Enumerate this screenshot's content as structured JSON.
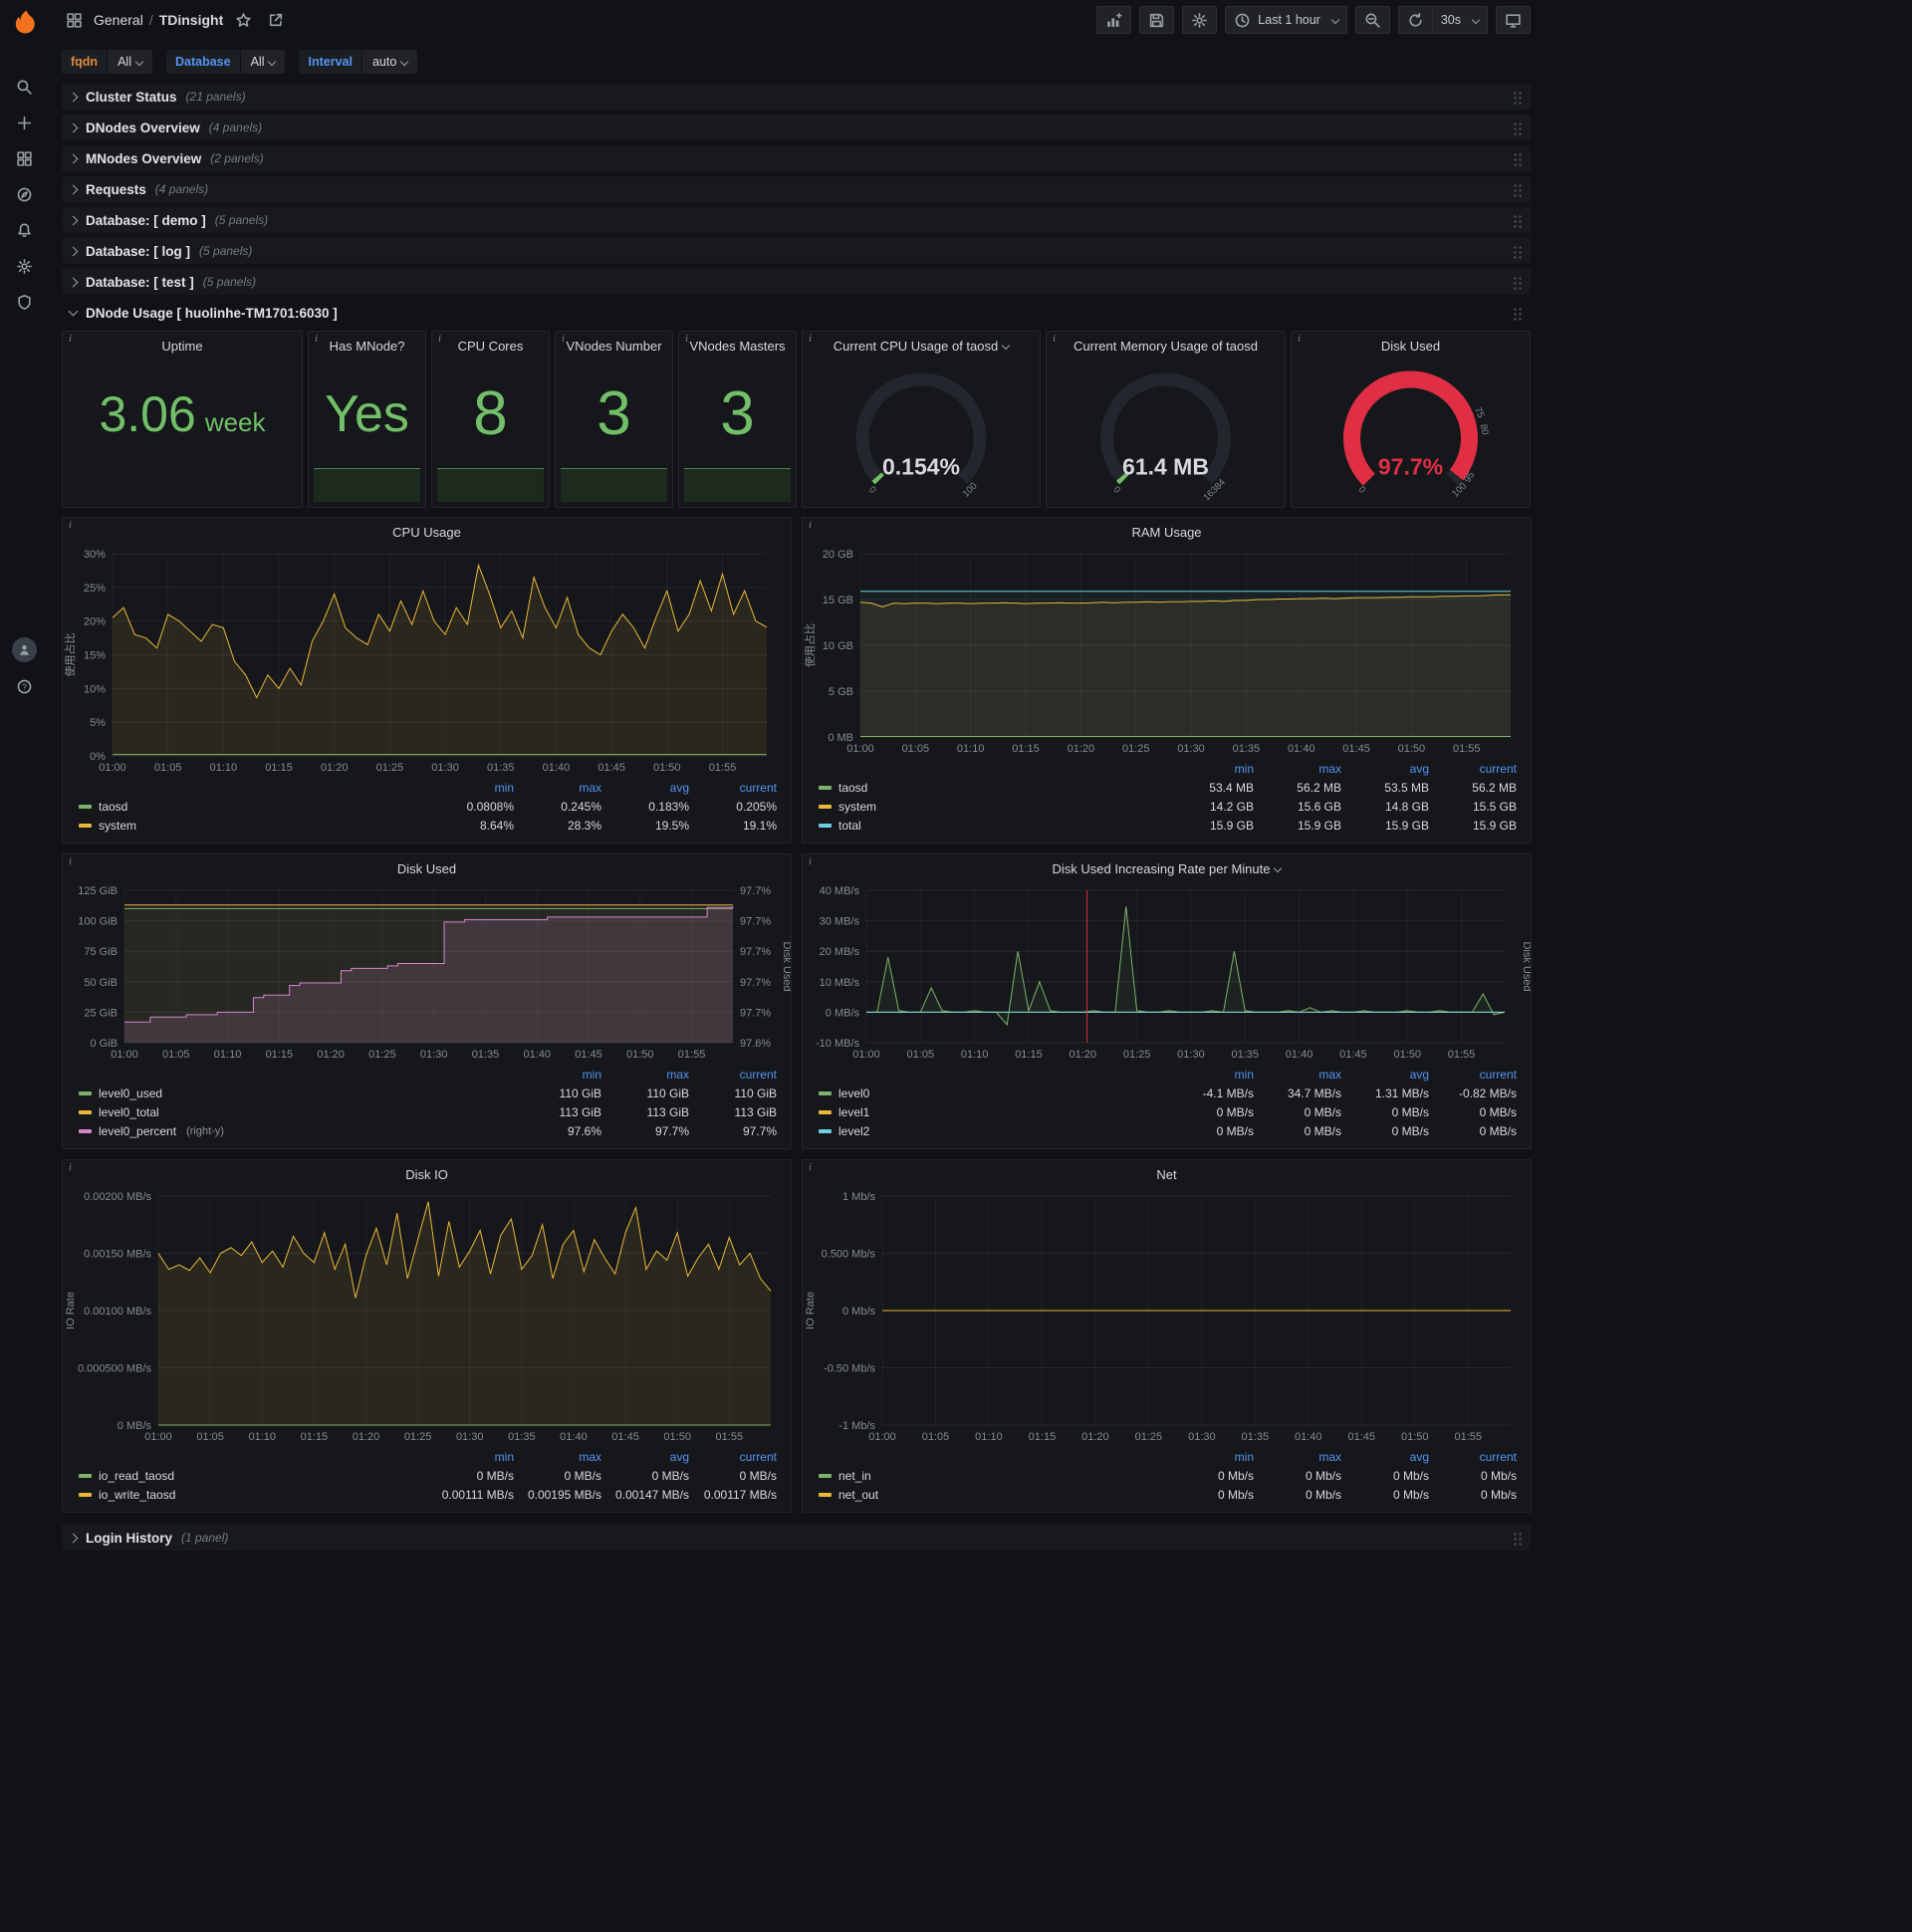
{
  "nav": {
    "breadcrumb": {
      "folder": "General",
      "sep": "/",
      "title": "TDinsight"
    },
    "time_picker": "Last 1 hour",
    "refresh": "30s"
  },
  "colors": {
    "green": "#73bf69",
    "yellow": "#eab839",
    "cyan": "#6ed0e0",
    "pink": "#d683ce",
    "red": "#e02f44",
    "legend_header_blue": "#5794f2"
  },
  "icons": {
    "sidebar": [
      "grafana-logo",
      "search",
      "plus",
      "dashboards",
      "explore",
      "alerting",
      "configuration",
      "server-admin"
    ],
    "sidebar_bottom": [
      "user-avatar",
      "help"
    ],
    "navbar_left": [
      "dashboard-grid",
      "star",
      "share"
    ],
    "navbar_right": [
      "add-panel",
      "save",
      "settings",
      "clock",
      "zoom-out",
      "refresh",
      "kiosk-tv"
    ]
  },
  "variables": [
    {
      "label": "fqdn",
      "value": "All",
      "label_color": "#e08a3e"
    },
    {
      "label": "Database",
      "value": "All",
      "label_color": "#5794f2"
    },
    {
      "label": "Interval",
      "value": "auto",
      "label_color": "#5794f2"
    }
  ],
  "rows": [
    {
      "title": "Cluster Status",
      "count": "(21 panels)"
    },
    {
      "title": "DNodes Overview",
      "count": "(4 panels)"
    },
    {
      "title": "MNodes Overview",
      "count": "(2 panels)"
    },
    {
      "title": "Requests",
      "count": "(4 panels)"
    },
    {
      "title": "Database: [ demo ]",
      "count": "(5 panels)"
    },
    {
      "title": "Database: [ log ]",
      "count": "(5 panels)"
    },
    {
      "title": "Database: [ test ]",
      "count": "(5 panels)"
    }
  ],
  "expanded_row": {
    "title": "DNode Usage [ huolinhe-TM1701:6030 ]"
  },
  "bottom_row": {
    "title": "Login History",
    "count": "(1 panel)"
  },
  "stats": [
    {
      "title": "Uptime",
      "value": "3.06",
      "unit": "week"
    },
    {
      "title": "Has MNode?",
      "value": "Yes"
    },
    {
      "title": "CPU Cores",
      "value": "8"
    },
    {
      "title": "VNodes Number",
      "value": "3"
    },
    {
      "title": "VNodes Masters",
      "value": "3"
    }
  ],
  "gauges": [
    {
      "title": "Current CPU Usage of taosd",
      "value": "0.154%",
      "min_label": "0",
      "max_label": "100",
      "fraction": 0.0015,
      "color": "#73bf69",
      "value_color": "#d8d9da",
      "ring": 13
    },
    {
      "title": "Current Memory Usage of taosd",
      "value": "61.4 MB",
      "min_label": "0",
      "max_label": "16384",
      "fraction": 0.0037,
      "color": "#73bf69",
      "value_color": "#d8d9da",
      "ring": 13
    },
    {
      "title": "Disk Used",
      "value": "97.7%",
      "min_label": "0",
      "max_label": "100",
      "fraction": 0.977,
      "color": "#e02f44",
      "value_color": "#e02f44",
      "ring": 17,
      "threshold_labels": [
        {
          "f": 0.75,
          "label": "75"
        },
        {
          "f": 0.8,
          "label": "80"
        },
        {
          "f": 0.95,
          "label": "95"
        }
      ]
    }
  ],
  "x_ticks": [
    "01:00",
    "01:05",
    "01:10",
    "01:15",
    "01:20",
    "01:25",
    "01:30",
    "01:35",
    "01:40",
    "01:45",
    "01:50",
    "01:55"
  ],
  "charts": {
    "cpu": {
      "title": "CPU Usage",
      "y_min": 0,
      "y_max": 30,
      "y_label": "使用占比",
      "y_ticks": [
        {
          "v": 30,
          "label": "30%"
        },
        {
          "v": 25,
          "label": "25%"
        },
        {
          "v": 20,
          "label": "20%"
        },
        {
          "v": 15,
          "label": "15%"
        },
        {
          "v": 10,
          "label": "10%"
        },
        {
          "v": 5,
          "label": "5%"
        },
        {
          "v": 0,
          "label": "0%"
        }
      ],
      "series": [
        {
          "name": "system",
          "color": "#eab839",
          "width": 1,
          "fill": 0.1,
          "values": [
            20.5,
            22,
            18,
            17.5,
            16,
            21,
            20,
            18.5,
            17,
            19.5,
            19,
            14,
            12,
            8.64,
            12,
            10,
            13,
            10.5,
            17,
            20,
            24,
            19,
            17.5,
            16.5,
            21,
            18.5,
            23,
            19.5,
            24.5,
            20,
            18,
            22,
            19.5,
            28.3,
            24,
            19,
            21.5,
            17.5,
            26.5,
            22,
            19,
            23.5,
            18,
            16,
            15,
            18.5,
            21,
            19,
            16,
            20.5,
            24.5,
            18.5,
            21,
            26,
            21.5,
            27,
            21,
            24.5,
            20,
            19.1
          ]
        },
        {
          "name": "taosd",
          "color": "#7eb26d",
          "width": 1,
          "flat": 0.2
        }
      ],
      "legend": {
        "cols": [
          "min",
          "max",
          "avg",
          "current"
        ],
        "rows": [
          {
            "name": "taosd",
            "color": "#7eb26d",
            "values": [
              "0.0808%",
              "0.245%",
              "0.183%",
              "0.205%"
            ]
          },
          {
            "name": "system",
            "color": "#eab839",
            "values": [
              "8.64%",
              "28.3%",
              "19.5%",
              "19.1%"
            ]
          }
        ]
      }
    },
    "ram": {
      "title": "RAM Usage",
      "y_min": 0,
      "y_max": 20,
      "y_label": "使用占比",
      "y_ticks": [
        {
          "v": 20,
          "label": "20 GB"
        },
        {
          "v": 15,
          "label": "15 GB"
        },
        {
          "v": 10,
          "label": "10 GB"
        },
        {
          "v": 5,
          "label": "5 GB"
        },
        {
          "v": 0,
          "label": "0 MB"
        }
      ],
      "series": [
        {
          "name": "system",
          "color": "#eab839",
          "width": 1,
          "fill": 0.09,
          "values": [
            14.7,
            14.6,
            14.2,
            14.6,
            14.55,
            14.6,
            14.6,
            14.55,
            14.6,
            14.6,
            14.55,
            14.6,
            14.6,
            14.65,
            14.6,
            14.55,
            14.6,
            14.6,
            14.65,
            14.6,
            14.6,
            14.65,
            14.7,
            14.65,
            14.7,
            14.7,
            14.75,
            14.7,
            14.75,
            14.75,
            14.8,
            14.8,
            14.85,
            14.8,
            14.9,
            14.9,
            15.0,
            15.0,
            15.05,
            15.05,
            15.1,
            15.1,
            15.15,
            15.1,
            15.15,
            15.2,
            15.2,
            15.2,
            15.25,
            15.25,
            15.3,
            15.3,
            15.3,
            15.35,
            15.35,
            15.4,
            15.4,
            15.45,
            15.5,
            15.5
          ]
        },
        {
          "name": "total",
          "color": "#6ed0e0",
          "width": 1,
          "fill": 0.05,
          "flat": 15.9
        },
        {
          "name": "taosd",
          "color": "#7eb26d",
          "width": 1,
          "flat": 0.053
        }
      ],
      "legend": {
        "cols": [
          "min",
          "max",
          "avg",
          "current"
        ],
        "rows": [
          {
            "name": "taosd",
            "color": "#7eb26d",
            "values": [
              "53.4 MB",
              "56.2 MB",
              "53.5 MB",
              "56.2 MB"
            ]
          },
          {
            "name": "system",
            "color": "#eab839",
            "values": [
              "14.2 GB",
              "15.6 GB",
              "14.8 GB",
              "15.5 GB"
            ]
          },
          {
            "name": "total",
            "color": "#6ed0e0",
            "values": [
              "15.9 GB",
              "15.9 GB",
              "15.9 GB",
              "15.9 GB"
            ]
          }
        ]
      }
    },
    "disk": {
      "title": "Disk Used",
      "y_min": 0,
      "y_max": 125,
      "y2_label": "Disk Used",
      "y_ticks": [
        {
          "v": 125,
          "label": "125 GiB"
        },
        {
          "v": 100,
          "label": "100 GiB"
        },
        {
          "v": 75,
          "label": "75 GiB"
        },
        {
          "v": 50,
          "label": "50 GiB"
        },
        {
          "v": 25,
          "label": "25 GiB"
        },
        {
          "v": 0,
          "label": "0 GiB"
        }
      ],
      "y2_labels": [
        "97.7%",
        "97.7%",
        "97.7%",
        "97.7%",
        "97.7%",
        "97.6%"
      ],
      "series": [
        {
          "name": "level0_used",
          "color": "#7eb26d",
          "width": 1,
          "fill": 0.07,
          "flat": 110
        },
        {
          "name": "level0_total",
          "color": "#eab839",
          "width": 1,
          "fill": 0.05,
          "flat": 113
        },
        {
          "name": "level0_percent",
          "color": "#d683ce",
          "width": 1,
          "fill": 0.16,
          "step": true,
          "points": [
            [
              0,
              17
            ],
            [
              2.5,
              21
            ],
            [
              6,
              23
            ],
            [
              9,
              25
            ],
            [
              12.5,
              37
            ],
            [
              13.5,
              39
            ],
            [
              16,
              47
            ],
            [
              17,
              49
            ],
            [
              21,
              59
            ],
            [
              22,
              61
            ],
            [
              25.5,
              63
            ],
            [
              26.5,
              65
            ],
            [
              30.5,
              65
            ],
            [
              31,
              99
            ],
            [
              33,
              101
            ],
            [
              40,
              101
            ],
            [
              41,
              103
            ],
            [
              55.5,
              103
            ],
            [
              56.5,
              111
            ],
            [
              59,
              112
            ]
          ]
        }
      ],
      "legend": {
        "cols": [
          "min",
          "max",
          "current"
        ],
        "rows": [
          {
            "name": "level0_used",
            "color": "#7eb26d",
            "values": [
              "110 GiB",
              "110 GiB",
              "110 GiB"
            ]
          },
          {
            "name": "level0_total",
            "color": "#eab839",
            "values": [
              "113 GiB",
              "113 GiB",
              "113 GiB"
            ]
          },
          {
            "name": "level0_percent",
            "color": "#d683ce",
            "suffix": "(right-y)",
            "values": [
              "97.6%",
              "97.7%",
              "97.7%"
            ]
          }
        ]
      }
    },
    "rate": {
      "title": "Disk Used Increasing Rate per Minute",
      "y_min": -10,
      "y_max": 40,
      "fill_base": 0,
      "y2_label": "Disk Used",
      "y_ticks": [
        {
          "v": 40,
          "label": "40 MB/s"
        },
        {
          "v": 30,
          "label": "30 MB/s"
        },
        {
          "v": 20,
          "label": "20 MB/s"
        },
        {
          "v": 10,
          "label": "10 MB/s"
        },
        {
          "v": 0,
          "label": "0 MB/s"
        },
        {
          "v": -10,
          "label": "-10 MB/s"
        }
      ],
      "annotations": [
        {
          "x": 20.4,
          "color": "#e02f44"
        }
      ],
      "series": [
        {
          "name": "level0",
          "color": "#7eb26d",
          "width": 1,
          "fill": 0.08,
          "values": [
            0,
            0,
            18,
            0.5,
            0,
            0,
            8,
            0.5,
            0,
            0,
            0.5,
            0,
            0,
            -4.1,
            20,
            0.5,
            10,
            0.5,
            0,
            0,
            0,
            0.5,
            0,
            0,
            34.7,
            0.5,
            0,
            0,
            0.5,
            0,
            0,
            0,
            0.5,
            0,
            20,
            0.5,
            0,
            0,
            0,
            0.5,
            0,
            1.5,
            0,
            0.5,
            0,
            0,
            0.5,
            0,
            0,
            0,
            0.5,
            0,
            0,
            0.5,
            0,
            0,
            0,
            6,
            -0.82,
            0
          ]
        },
        {
          "name": "level1",
          "color": "#eab839",
          "width": 1,
          "flat": 0
        },
        {
          "name": "level2",
          "color": "#6ed0e0",
          "width": 1,
          "flat": 0
        }
      ],
      "legend": {
        "cols": [
          "min",
          "max",
          "avg",
          "current"
        ],
        "rows": [
          {
            "name": "level0",
            "color": "#7eb26d",
            "values": [
              "-4.1 MB/s",
              "34.7 MB/s",
              "1.31 MB/s",
              "-0.82 MB/s"
            ]
          },
          {
            "name": "level1",
            "color": "#eab839",
            "values": [
              "0 MB/s",
              "0 MB/s",
              "0 MB/s",
              "0 MB/s"
            ]
          },
          {
            "name": "level2",
            "color": "#6ed0e0",
            "values": [
              "0 MB/s",
              "0 MB/s",
              "0 MB/s",
              "0 MB/s"
            ]
          }
        ]
      }
    },
    "io": {
      "title": "Disk IO",
      "y_min": 0,
      "y_max": 0.002,
      "y_label": "IO Rate",
      "y_ticks": [
        {
          "v": 0.002,
          "label": "0.00200 MB/s"
        },
        {
          "v": 0.0015,
          "label": "0.00150 MB/s"
        },
        {
          "v": 0.001,
          "label": "0.00100 MB/s"
        },
        {
          "v": 0.0005,
          "label": "0.000500 MB/s"
        },
        {
          "v": 0,
          "label": "0 MB/s"
        }
      ],
      "series": [
        {
          "name": "io_write_taosd",
          "color": "#eab839",
          "width": 1,
          "fill": 0.1,
          "values": [
            0.0015,
            0.00136,
            0.0014,
            0.00135,
            0.00146,
            0.00133,
            0.0015,
            0.00155,
            0.00148,
            0.0016,
            0.00142,
            0.00152,
            0.00138,
            0.00165,
            0.0015,
            0.00142,
            0.00168,
            0.00136,
            0.00158,
            0.00111,
            0.00148,
            0.00172,
            0.0014,
            0.00185,
            0.00128,
            0.00162,
            0.00195,
            0.0013,
            0.00178,
            0.00138,
            0.00152,
            0.0017,
            0.00132,
            0.00166,
            0.0018,
            0.00136,
            0.00148,
            0.00175,
            0.00128,
            0.00158,
            0.0017,
            0.00134,
            0.00162,
            0.00146,
            0.00132,
            0.00168,
            0.0019,
            0.00136,
            0.00152,
            0.00144,
            0.00168,
            0.0013,
            0.00146,
            0.00158,
            0.00136,
            0.00164,
            0.0014,
            0.0015,
            0.00128,
            0.00117
          ]
        },
        {
          "name": "io_read_taosd",
          "color": "#7eb26d",
          "width": 1,
          "flat": 0
        }
      ],
      "legend": {
        "cols": [
          "min",
          "max",
          "avg",
          "current"
        ],
        "rows": [
          {
            "name": "io_read_taosd",
            "color": "#7eb26d",
            "values": [
              "0 MB/s",
              "0 MB/s",
              "0 MB/s",
              "0 MB/s"
            ]
          },
          {
            "name": "io_write_taosd",
            "color": "#eab839",
            "values": [
              "0.00111 MB/s",
              "0.00195 MB/s",
              "0.00147 MB/s",
              "0.00117 MB/s"
            ]
          }
        ]
      }
    },
    "net": {
      "title": "Net",
      "y_min": -1,
      "y_max": 1,
      "y_label": "IO Rate",
      "y_ticks": [
        {
          "v": 1,
          "label": "1 Mb/s"
        },
        {
          "v": 0.5,
          "label": "0.500 Mb/s"
        },
        {
          "v": 0,
          "label": "0 Mb/s"
        },
        {
          "v": -0.5,
          "label": "-0.50 Mb/s"
        },
        {
          "v": -1,
          "label": "-1 Mb/s"
        }
      ],
      "series": [
        {
          "name": "net_in",
          "color": "#7eb26d",
          "width": 1,
          "flat": 0
        },
        {
          "name": "net_out",
          "color": "#eab839",
          "width": 1,
          "flat": 0
        }
      ],
      "legend": {
        "cols": [
          "min",
          "max",
          "avg",
          "current"
        ],
        "rows": [
          {
            "name": "net_in",
            "color": "#7eb26d",
            "values": [
              "0 Mb/s",
              "0 Mb/s",
              "0 Mb/s",
              "0 Mb/s"
            ]
          },
          {
            "name": "net_out",
            "color": "#eab839",
            "values": [
              "0 Mb/s",
              "0 Mb/s",
              "0 Mb/s",
              "0 Mb/s"
            ]
          }
        ]
      }
    }
  }
}
